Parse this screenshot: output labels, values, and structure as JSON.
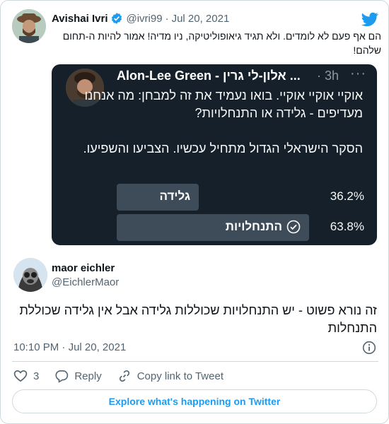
{
  "parent_tweet": {
    "name": "Avishai Ivri",
    "handle": "@ivri99",
    "separator": "·",
    "date": "Jul 20, 2021",
    "text": "הם אף פעם לא לומדים. ולא תגיד גיאופוליטיקה, ניו מדיה! אמור להיות ה-תחום שלהם!",
    "icons": {
      "verified": "verified-badge-icon",
      "brand": "twitter-bird-icon"
    }
  },
  "embedded_tweet": {
    "name": "Alon-Lee Green - אלון-לי גרין ...",
    "separator": "·",
    "time": "3h",
    "more": "···",
    "paragraph1": "אוקיי אוקיי אוקיי. בואו נעמיד את זה למבחן: מה אנחנו מעדיפים - גלידה או התנחלויות?",
    "paragraph2": "הסקר הישראלי הגדול מתחיל עכשיו. הצביעו והשפיעו.",
    "poll": [
      {
        "label": "גלידה",
        "percent_text": "36.2%",
        "percent": 36.2,
        "selected": false
      },
      {
        "label": "התנחלויות",
        "percent_text": "63.8%",
        "percent": 63.8,
        "selected": true
      }
    ]
  },
  "main_tweet": {
    "name": "maor eichler",
    "handle": "@EichlerMaor",
    "text": "זה נורא פשוט - יש התנחלויות שכוללות גלידה אבל אין גלידה שכוללת התנחלות",
    "time": "10:10 PM",
    "separator": "·",
    "date": "Jul 20, 2021"
  },
  "actions": {
    "like_count": "3",
    "reply_label": "Reply",
    "copy_link_label": "Copy link to Tweet"
  },
  "explore_label": "Explore what's happening on Twitter",
  "colors": {
    "brand": "#1d9bf0",
    "dark_bg": "#15202b",
    "poll_bar": "#3e4c5a",
    "muted": "#536471"
  }
}
